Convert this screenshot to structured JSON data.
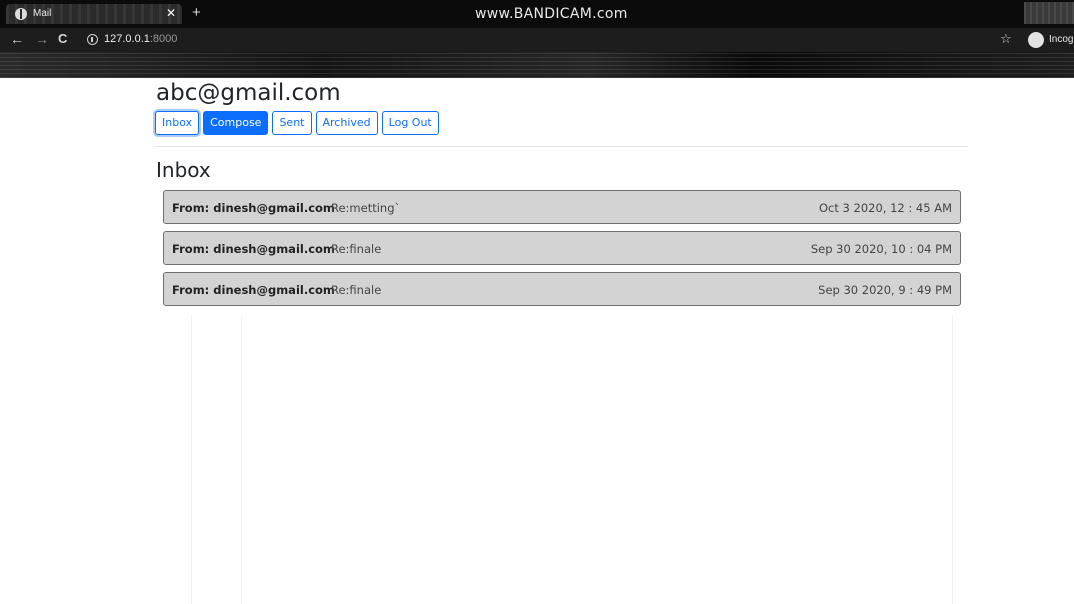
{
  "browser": {
    "tab_title": "Mail",
    "tab_close": "✕",
    "new_tab": "+",
    "watermark": "www.BANDICAM.com",
    "back": "←",
    "forward": "→",
    "reload": "C",
    "url_host": "127.0.0.1",
    "url_port": ":8000",
    "bookmark_star": "☆",
    "incognito_label": "Incogn"
  },
  "header": {
    "user_email": "abc@gmail.com",
    "buttons": [
      "Inbox",
      "Compose",
      "Sent",
      "Archived",
      "Log Out"
    ]
  },
  "mailbox": {
    "title": "Inbox",
    "emails": [
      {
        "sender": "From:  dinesh@gmail.com",
        "subject": "Re:metting`",
        "timestamp": "Oct 3 2020, 12 : 45 AM"
      },
      {
        "sender": "From:  dinesh@gmail.com",
        "subject": "Re:finale",
        "timestamp": "Sep 30 2020, 10 : 04 PM"
      },
      {
        "sender": "From:  dinesh@gmail.com",
        "subject": "Re:finale",
        "timestamp": "Sep 30 2020, 9 : 49 PM"
      }
    ]
  },
  "colors": {
    "accent": "#0d6efd",
    "row_background": "#d3d3d3",
    "row_border": "#6f6f6f"
  }
}
